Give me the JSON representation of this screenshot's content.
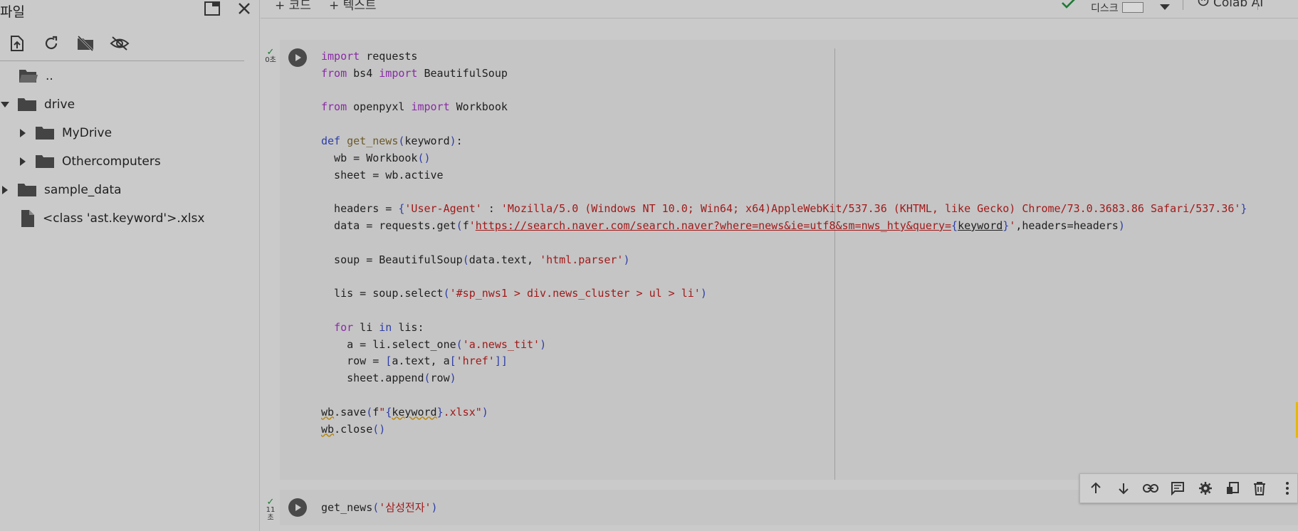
{
  "files_panel": {
    "title": "파일",
    "tree": [
      {
        "label": "..",
        "type": "folder-open",
        "indent": 0,
        "caret": "none"
      },
      {
        "label": "drive",
        "type": "folder",
        "indent": 0,
        "caret": "expanded"
      },
      {
        "label": "MyDrive",
        "type": "folder",
        "indent": 1,
        "caret": "collapsed"
      },
      {
        "label": "Othercomputers",
        "type": "folder",
        "indent": 1,
        "caret": "collapsed"
      },
      {
        "label": "sample_data",
        "type": "folder",
        "indent": 0,
        "caret": "collapsed"
      },
      {
        "label": "<class 'ast.keyword'>.xlsx",
        "type": "file",
        "indent": 0,
        "caret": "none"
      }
    ]
  },
  "topbar": {
    "add_code": "+ 코드",
    "add_text": "+ 텍스트",
    "disk_label": "디스크",
    "colab_ai": "Colab AI"
  },
  "cells": [
    {
      "exec_time": "0초"
    },
    {
      "exec_time_line1": "11",
      "exec_time_line2": "초",
      "code": "get_news('삼성전자')"
    }
  ],
  "colors": {
    "background": "#cacaca",
    "cell_bg": "#c5c5c5",
    "keyword": "#8a2aa6",
    "string": "#a11a1a",
    "success": "#1e7a35"
  }
}
